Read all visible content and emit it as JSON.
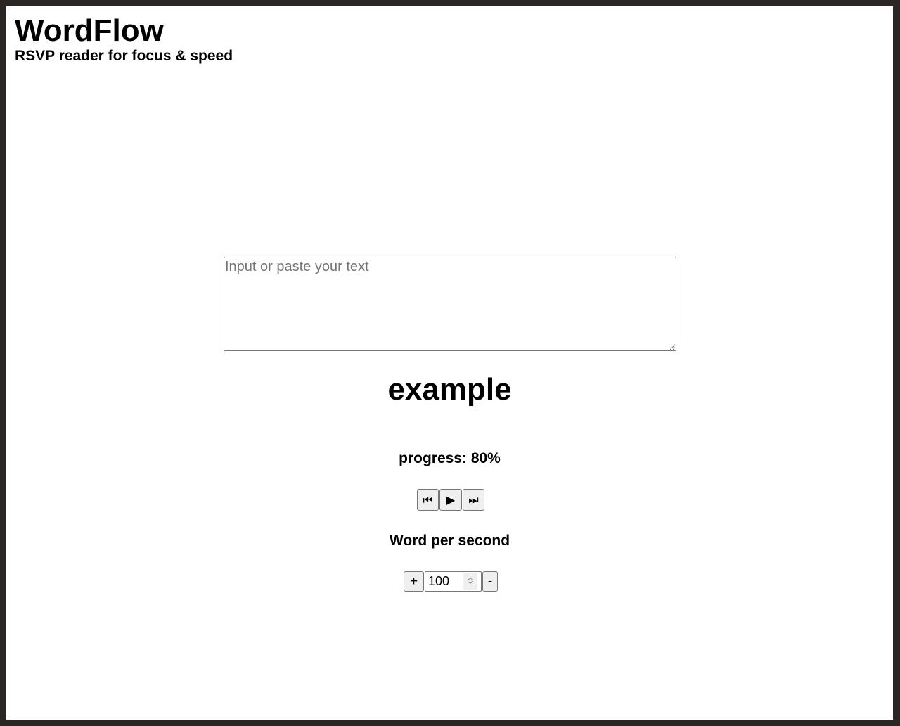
{
  "header": {
    "title": "WordFlow",
    "subtitle": "RSVP reader for focus & speed"
  },
  "input": {
    "placeholder": "Input or paste your text",
    "value": ""
  },
  "reader": {
    "current_word": "example",
    "progress_text": "progress: 80%",
    "progress_percent": 80
  },
  "playback": {
    "previous_icon": "⏮",
    "play_icon": "▶",
    "next_icon": "⏭"
  },
  "speed": {
    "label": "Word per second",
    "increase_label": "+",
    "decrease_label": "-",
    "value": "100"
  },
  "icons": {
    "previous": "skip-back-icon",
    "play": "play-icon",
    "next": "skip-forward-icon",
    "spinner_up": "chevron-up-icon",
    "spinner_down": "chevron-down-icon"
  }
}
